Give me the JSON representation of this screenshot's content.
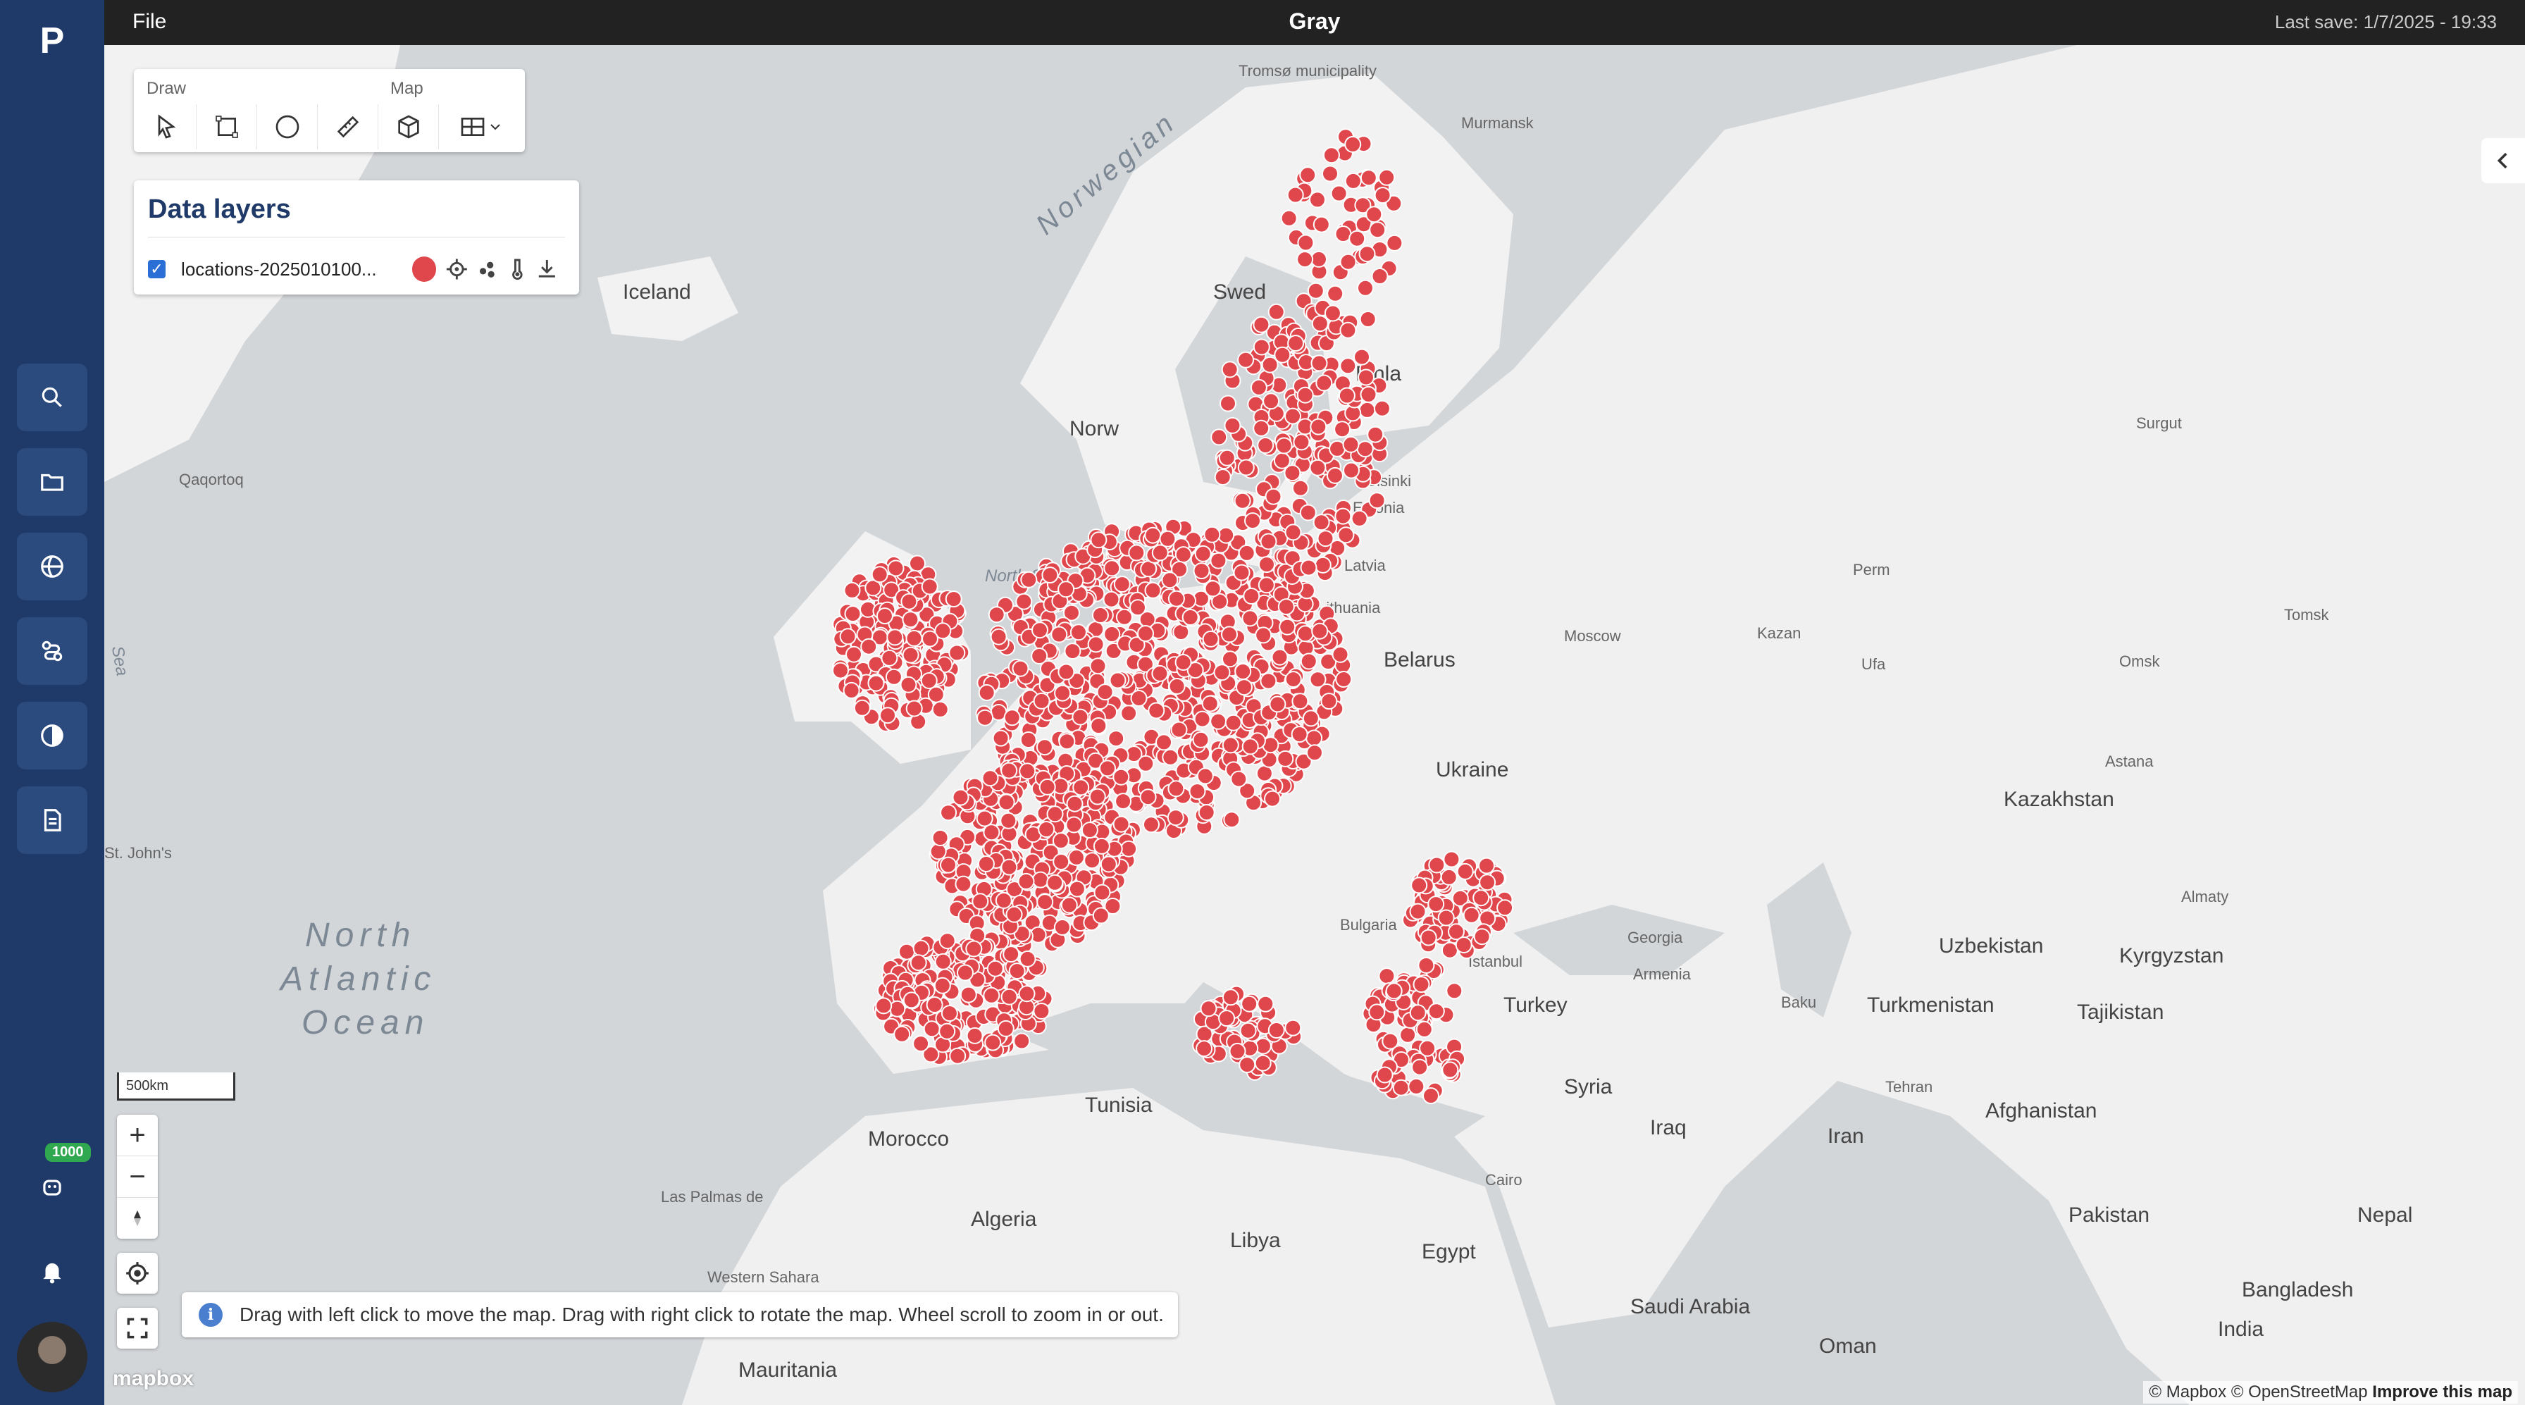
{
  "app": {
    "title": "Gray",
    "menu_file": "File",
    "last_save": "Last save: 1/7/2025 - 19:33",
    "logo_letter": "P"
  },
  "nav": {
    "notifications_badge": "1000"
  },
  "toolbar": {
    "draw_label": "Draw",
    "map_label": "Map"
  },
  "layers": {
    "title": "Data layers",
    "items": [
      {
        "name": "locations-2025010100...",
        "checked": true,
        "color": "#e0474c"
      }
    ]
  },
  "map": {
    "scale_label": "500km",
    "hint": "Drag with left click to move the map. Drag with right click to rotate the map. Wheel scroll to zoom in or out.",
    "attribution": "© Mapbox © OpenStreetMap",
    "improve": "Improve this map",
    "mapbox_logo": "mapbox",
    "labels": {
      "iceland": "Iceland",
      "norwegian": "Norwegian",
      "north_sea": "North Sea",
      "atlantic_1": "North",
      "atlantic_2": "Atlantic",
      "atlantic_3": "Ocean",
      "sweden": "Swed",
      "finland": "Finla",
      "norway": "Norw",
      "belarus": "Belarus",
      "ukraine": "Ukraine",
      "kazakhstan": "Kazakhstan",
      "turkey": "Turkey",
      "syria": "Syria",
      "iraq": "Iraq",
      "iran": "Iran",
      "afghanistan": "Afghanistan",
      "pakistan": "Pakistan",
      "nepal": "Nepal",
      "bangladesh": "Bangladesh",
      "india": "India",
      "oman": "Oman",
      "saudi": "Saudi Arabia",
      "egypt": "Egypt",
      "libya": "Libya",
      "algeria": "Algeria",
      "tunisia": "Tunisia",
      "morocco": "Morocco",
      "mauritania": "Mauritania",
      "uzbekistan": "Uzbekistan",
      "turkmenistan": "Turkmenistan",
      "tajikistan": "Tajikistan",
      "kyrgyzstan": "Kyrgyzstan",
      "estonia": "Estonia",
      "latvia": "Latvia",
      "lithuania": "Lithuania",
      "bulgaria": "Bulgaria",
      "georgia": "Georgia",
      "armenia": "Armenia",
      "moscow": "Moscow",
      "helsinki": "Helsinki",
      "istanbul": "Istanbul",
      "cairo": "Cairo",
      "tehran": "Tehran",
      "baku": "Baku",
      "kazan": "Kazan",
      "perm": "Perm",
      "ufa": "Ufa",
      "omsk": "Omsk",
      "astana": "Astana",
      "almaty": "Almaty",
      "tomsk": "Tomsk",
      "murmansk": "Murmansk",
      "tromso": "Tromsø municipality",
      "surgut": "Surgut",
      "western_sahara": "Western Sahara",
      "las_palmas": "Las Palmas de",
      "st_johns": "St. John's",
      "qaqortoq": "Qaqortoq",
      "sea": "Sea"
    }
  }
}
